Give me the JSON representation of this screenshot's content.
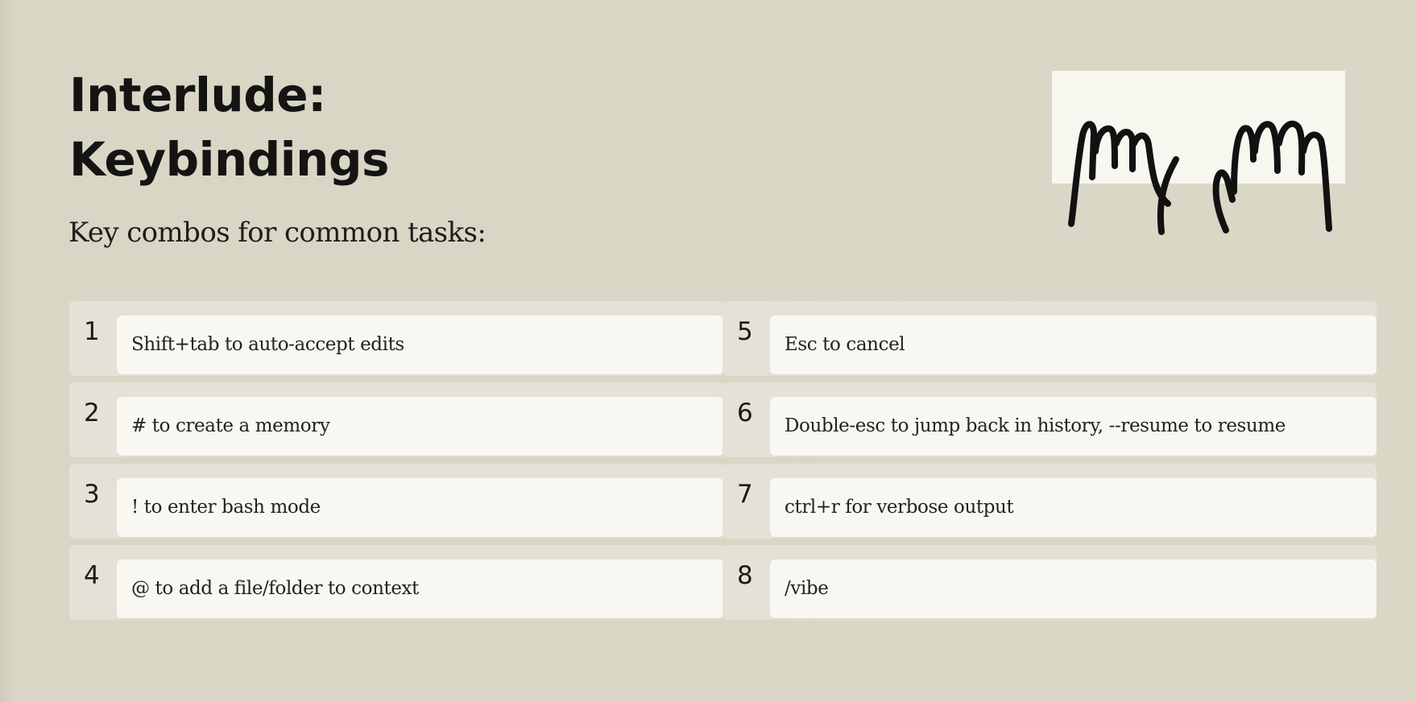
{
  "title_line1": "Interlude:",
  "title_line2": "Keybindings",
  "subtitle": "Key combos for common tasks:",
  "illustration": "hands-on-keyboard-icon",
  "left_items": [
    {
      "num": "1",
      "text": "Shift+tab to auto-accept edits"
    },
    {
      "num": "2",
      "text": "# to create a memory"
    },
    {
      "num": "3",
      "text": "! to enter bash mode"
    },
    {
      "num": "4",
      "text": "@ to add a file/folder to context"
    }
  ],
  "right_items": [
    {
      "num": "5",
      "text": "Esc to cancel"
    },
    {
      "num": "6",
      "text": "Double-esc to jump back in history, --resume to resume"
    },
    {
      "num": "7",
      "text": "ctrl+r for verbose output"
    },
    {
      "num": "8",
      "text": "/vibe"
    }
  ]
}
